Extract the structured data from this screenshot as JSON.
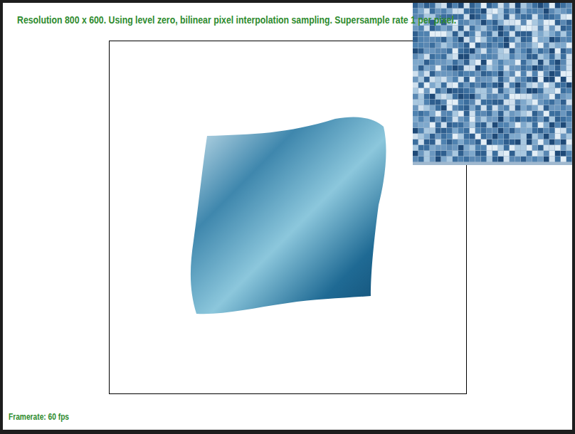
{
  "header": {
    "text": "Resolution 800 x 600. Using level zero, bilinear pixel interpolation sampling. Supersample rate 1 per pixel."
  },
  "status": {
    "framerate": "Framerate: 60 fps"
  }
}
